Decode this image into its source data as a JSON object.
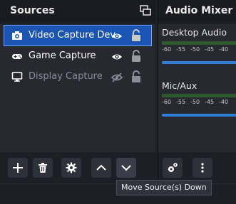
{
  "sources_dock": {
    "title": "Sources",
    "items": [
      {
        "label": "Video Capture Dev",
        "type_icon": "camera-icon",
        "visible": true,
        "selected": true
      },
      {
        "label": "Game Capture",
        "type_icon": "gamepad-icon",
        "visible": true,
        "selected": false
      },
      {
        "label": "Display Capture",
        "type_icon": "monitor-icon",
        "visible": false,
        "selected": false
      }
    ],
    "toolbar": [
      "plus-icon",
      "trash-icon",
      "gear-icon",
      "chevron-up-icon",
      "chevron-down-icon"
    ]
  },
  "mixer_dock": {
    "title": "Audio Mixer",
    "channels": [
      {
        "name": "Desktop Audio",
        "ticks": [
          "-60",
          "-55",
          "-50",
          "-45",
          "-40"
        ]
      },
      {
        "name": "Mic/Aux",
        "ticks": [
          "-60",
          "-55",
          "-50",
          "-45",
          "-40"
        ]
      }
    ],
    "toolbar": [
      "advanced-audio-gear-icon",
      "more-vertical-icon"
    ]
  },
  "tooltip": {
    "text": "Move Source(s) Down"
  },
  "colors": {
    "selection": "#1a55b3",
    "fader": "#2d7fd6",
    "background": "#272830"
  }
}
